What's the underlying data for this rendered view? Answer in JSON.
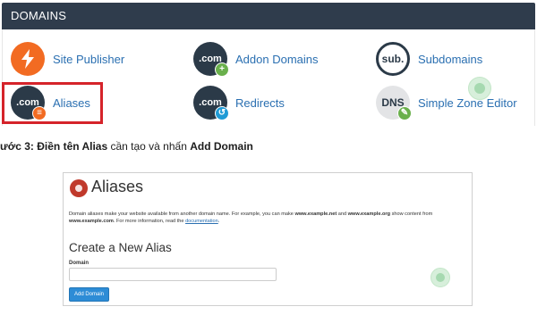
{
  "domains_panel": {
    "title": "DOMAINS",
    "items": [
      {
        "label": "Site Publisher",
        "icon": "lightning-bolt-icon",
        "icon_text": ""
      },
      {
        "label": "Addon Domains",
        "icon": "dot-com-add-icon",
        "icon_text": ".com"
      },
      {
        "label": "Subdomains",
        "icon": "sub-icon",
        "icon_text": "sub."
      },
      {
        "label": "Aliases",
        "icon": "dot-com-list-icon",
        "icon_text": ".com"
      },
      {
        "label": "Redirects",
        "icon": "dot-com-redirect-icon",
        "icon_text": ".com"
      },
      {
        "label": "Simple Zone Editor",
        "icon": "dns-edit-icon",
        "icon_text": "DNS"
      }
    ]
  },
  "step_instruction": {
    "prefix": "ước 3: Điền tên Alias",
    "middle": " cần tạo và nhấn ",
    "suffix": "Add Domain"
  },
  "aliases_page": {
    "title": "Aliases",
    "desc_1": "Domain aliases make your website available from another domain name. For example, you can make ",
    "desc_example_net": "www.example.net",
    "desc_2": " and ",
    "desc_example_org": "www.example.org",
    "desc_3": " show content from ",
    "desc_example_com": "www.example.com",
    "desc_4": ". For more information, read the ",
    "desc_link": "documentation",
    "desc_5": ".",
    "create_heading": "Create a New Alias",
    "domain_label": "Domain",
    "domain_value": "",
    "button_label": "Add Domain"
  },
  "colors": {
    "header_bg": "#2f3c4c",
    "link": "#2a6fb1",
    "highlight": "#d5232a",
    "button": "#2d8cd6"
  }
}
